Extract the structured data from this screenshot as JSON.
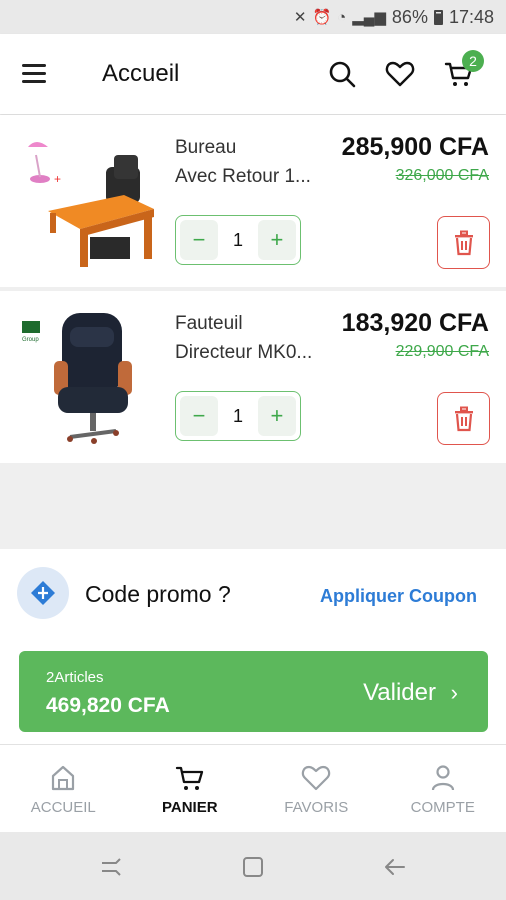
{
  "status_bar": {
    "battery": "86%",
    "time": "17:48"
  },
  "app_bar": {
    "title": "Accueil",
    "cart_count": "2"
  },
  "cart": {
    "items": [
      {
        "name_line1": "Bureau",
        "name_line2": "Avec Retour 1...",
        "price": "285,900 CFA",
        "old_price": "326,000 CFA",
        "quantity": "1"
      },
      {
        "name_line1": "Fauteuil",
        "name_line2": "Directeur MK0...",
        "price": "183,920 CFA",
        "old_price": "229,900 CFA",
        "quantity": "1"
      }
    ]
  },
  "promo": {
    "label": "Code promo ?",
    "action": "Appliquer Coupon"
  },
  "checkout": {
    "articles": "2Articles",
    "total": "469,820 CFA",
    "button_label": "Valider"
  },
  "bottom_nav": [
    {
      "label": "ACCUEIL",
      "icon": "home-icon"
    },
    {
      "label": "PANIER",
      "icon": "cart-icon"
    },
    {
      "label": "FAVORIS",
      "icon": "heart-icon"
    },
    {
      "label": "COMPTE",
      "icon": "person-icon"
    }
  ],
  "colors": {
    "accent_green": "#5cb85c",
    "link_blue": "#2d7cd6",
    "delete_red": "#e0554d"
  }
}
